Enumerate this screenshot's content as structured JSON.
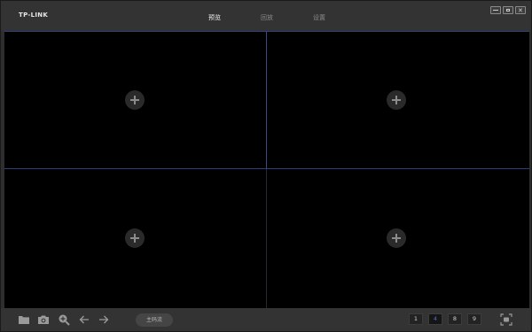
{
  "app": {
    "logo": "TP-LINK"
  },
  "nav": {
    "tabs": [
      {
        "label": "预览",
        "active": true
      },
      {
        "label": "回放",
        "active": false
      },
      {
        "label": "设置",
        "active": false
      }
    ]
  },
  "window_controls": [
    "minimize-icon",
    "maximize-icon",
    "close-icon"
  ],
  "panes": [
    {
      "icon": "plus-icon"
    },
    {
      "icon": "plus-icon"
    },
    {
      "icon": "plus-icon"
    },
    {
      "icon": "plus-icon"
    }
  ],
  "toolbar": {
    "tools": [
      "folder-icon",
      "camera-icon",
      "zoom-in-icon",
      "arrow-left-icon",
      "arrow-right-icon"
    ],
    "stream_label": "主码流",
    "layouts": [
      "1",
      "4",
      "8",
      "9"
    ],
    "active_layout": "4",
    "fullscreen_icon": "fullscreen-icon"
  },
  "colors": {
    "accent": "#5a6cc0",
    "pane_divider": "#3a4a86",
    "background": "#000000",
    "chrome": "#333333"
  }
}
